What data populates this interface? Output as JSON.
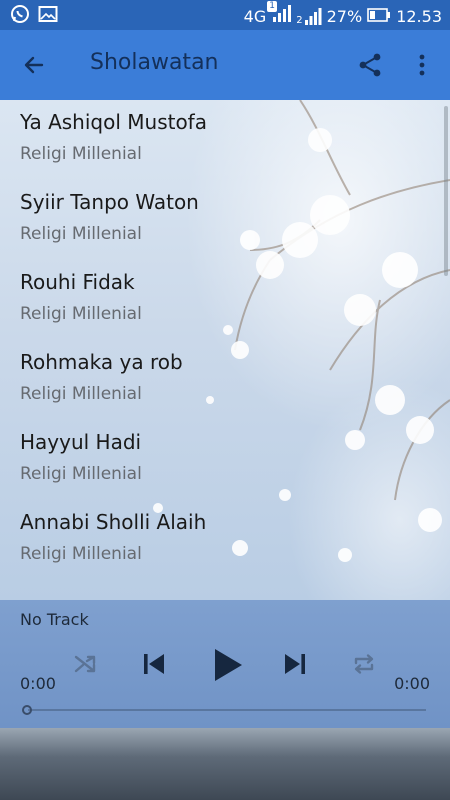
{
  "status_bar": {
    "network": "4G",
    "sim_badge": "1",
    "sim2_label": "2",
    "battery": "27%",
    "time": "12.53"
  },
  "app_bar": {
    "title": "Sholawatan"
  },
  "songs": [
    {
      "title": "Ya Ashiqol Mustofa",
      "artist": "Religi Millenial"
    },
    {
      "title": "Syiir Tanpo Waton",
      "artist": "Religi Millenial"
    },
    {
      "title": "Rouhi Fidak",
      "artist": "Religi Millenial"
    },
    {
      "title": "Rohmaka ya rob",
      "artist": "Religi Millenial"
    },
    {
      "title": "Hayyul Hadi",
      "artist": "Religi Millenial"
    },
    {
      "title": "Annabi Sholli Alaih",
      "artist": "Religi Millenial"
    }
  ],
  "player": {
    "track": "No Track",
    "elapsed": "0:00",
    "duration": "0:00",
    "progress": 0
  },
  "colors": {
    "status_bar": "#2a65b7",
    "app_bar": "#3b7dd8",
    "player": "#7fa0cf"
  }
}
